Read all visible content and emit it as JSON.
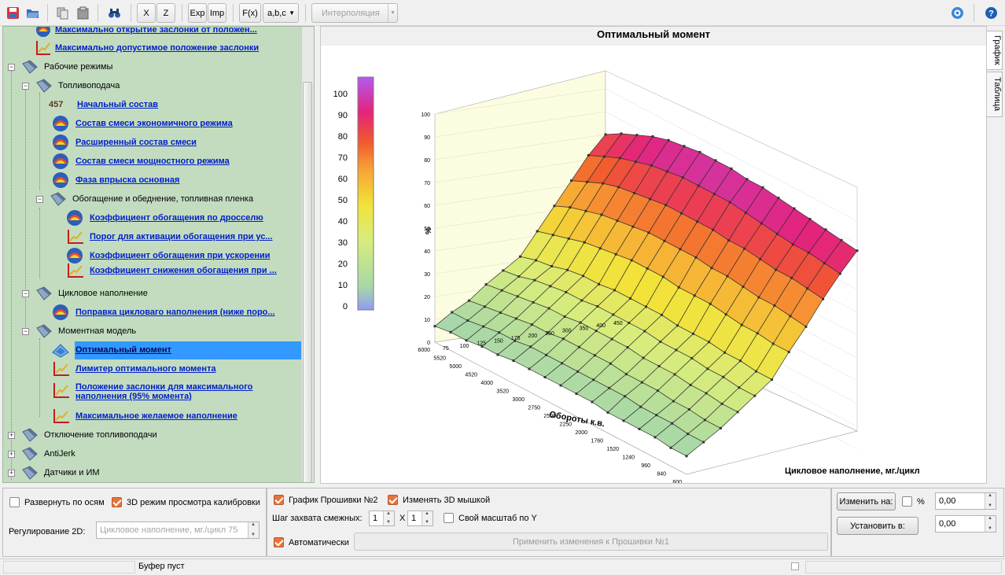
{
  "toolbar": {
    "btn_x": "X",
    "btn_z": "Z",
    "btn_exp": "Exp",
    "btn_imp": "Imp",
    "btn_fx": "F(x)",
    "btn_abc": "a,b,c",
    "interpolation": "Интерполяция"
  },
  "tree": {
    "items": [
      {
        "label": "Максимально открытие заслонки от положен..."
      },
      {
        "label": "Максимально допустимое положение заслонки"
      },
      {
        "label": "Рабочие режимы"
      },
      {
        "label": "Топливоподача"
      },
      {
        "label": "Начальный состав",
        "badge": "457"
      },
      {
        "label": "Состав смеси экономичного режима"
      },
      {
        "label": "Расширенный состав смеси"
      },
      {
        "label": "Состав смеси мощностного режима"
      },
      {
        "label": "Фаза впрыска основная"
      },
      {
        "label": "Обогащение и обеднение, топливная пленка"
      },
      {
        "label": "Коэффициент обогащения по дросселю"
      },
      {
        "label": "Порог для активации обогащения при ус..."
      },
      {
        "label": "Коэффициент обогащения при ускорении"
      },
      {
        "label": "Коэффициент снижения обогащения при ..."
      },
      {
        "label": "Цикловое наполнение"
      },
      {
        "label": "Поправка цикловаго наполнения (ниже поро..."
      },
      {
        "label": "Моментная модель"
      },
      {
        "label": "Оптимальный момент"
      },
      {
        "label": "Лимитер оптимального момента"
      },
      {
        "label": "Положение заслонки для максимального"
      },
      {
        "label": "наполнения (95% момента)"
      },
      {
        "label": "Максимальное желаемое наполнение"
      },
      {
        "label": "Отключение топливоподачи"
      },
      {
        "label": "AntiJerk"
      },
      {
        "label": "Датчики и ИМ"
      }
    ]
  },
  "chart": {
    "title": "Оптимальный момент",
    "tab_graph": "График",
    "tab_table": "Таблица",
    "scale_labels": [
      "100",
      "90",
      "80",
      "70",
      "60",
      "50",
      "40",
      "30",
      "20",
      "10",
      "0"
    ]
  },
  "chart_data": {
    "type": "surface3d",
    "title": "Оптимальный момент",
    "xlabel": "Обороты к.в.",
    "ylabel": "Цикловое наполнение, мг./цикл",
    "zlabel": "%",
    "x": [
      600,
      840,
      960,
      1240,
      1520,
      1760,
      2000,
      2250,
      2500,
      2750,
      3000,
      3520,
      4000,
      4520,
      5000,
      5520,
      6000
    ],
    "y": [
      75,
      100,
      125,
      150,
      175,
      200,
      250,
      300,
      350,
      400,
      450
    ],
    "z_range": [
      0,
      100
    ],
    "values": [
      [
        8,
        13,
        18,
        24,
        30,
        36,
        47,
        57,
        68,
        78,
        87
      ],
      [
        8,
        13,
        18,
        24,
        30,
        36,
        47,
        58,
        69,
        79,
        88
      ],
      [
        9,
        14,
        19,
        25,
        31,
        37,
        48,
        59,
        70,
        80,
        89
      ],
      [
        9,
        14,
        19,
        25,
        31,
        37,
        48,
        59,
        70,
        80,
        90
      ],
      [
        9,
        14,
        20,
        26,
        32,
        38,
        49,
        60,
        71,
        81,
        91
      ],
      [
        9,
        15,
        20,
        26,
        32,
        38,
        50,
        61,
        72,
        82,
        92
      ],
      [
        10,
        15,
        20,
        26,
        32,
        38,
        50,
        61,
        72,
        83,
        93
      ],
      [
        10,
        15,
        21,
        27,
        33,
        39,
        50,
        62,
        73,
        84,
        93
      ],
      [
        10,
        15,
        21,
        27,
        33,
        39,
        51,
        62,
        73,
        84,
        94
      ],
      [
        10,
        15,
        21,
        27,
        33,
        39,
        51,
        62,
        73,
        84,
        94
      ],
      [
        10,
        15,
        21,
        27,
        33,
        39,
        51,
        62,
        73,
        84,
        94
      ],
      [
        10,
        15,
        20,
        26,
        32,
        38,
        50,
        61,
        72,
        83,
        93
      ],
      [
        9,
        14,
        20,
        26,
        32,
        38,
        49,
        60,
        71,
        82,
        92
      ],
      [
        9,
        14,
        19,
        25,
        31,
        37,
        48,
        59,
        70,
        80,
        90
      ],
      [
        8,
        13,
        18,
        24,
        30,
        35,
        46,
        57,
        68,
        78,
        87
      ],
      [
        8,
        12,
        17,
        23,
        28,
        34,
        44,
        55,
        65,
        75,
        84
      ],
      [
        7,
        12,
        16,
        22,
        27,
        32,
        42,
        52,
        62,
        72,
        80
      ]
    ]
  },
  "bottom_left": {
    "expand_axes": "Развернуть по осям",
    "mode_3d": "3D режим просмотра калибровки",
    "reg2d_label": "Регулирование 2D:",
    "reg2d_value": "Цикловое наполнение, мг./цикл 75"
  },
  "bottom_mid": {
    "graph2": "График Прошивки №2",
    "change_3d_mouse": "Изменять 3D мышкой",
    "step_label": "Шаг захвата смежных:",
    "step_x": "1",
    "x_sep": "X",
    "step_z": "1",
    "own_scale": "Свой масштаб по Y",
    "auto": "Автоматически",
    "apply": "Применить изменения к Прошивки №1"
  },
  "bottom_right": {
    "change_on": "Изменить на:",
    "percent": "%",
    "change_value": "0,00",
    "set_to": "Установить в:",
    "set_value": "0,00"
  },
  "status": {
    "buffer": "Буфер пуст"
  }
}
